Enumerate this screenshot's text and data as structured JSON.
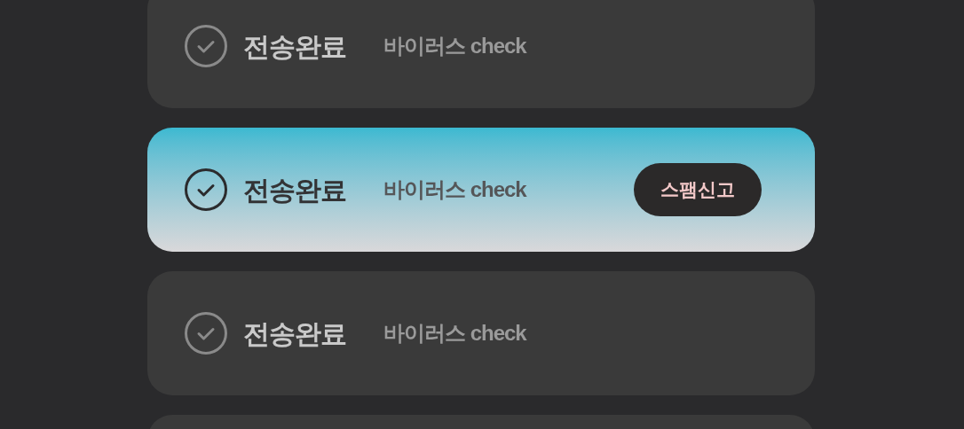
{
  "transfers": [
    {
      "status": "전송완료",
      "detail": "바이러스 check",
      "selected": false
    },
    {
      "status": "전송완료",
      "detail": "바이러스 check",
      "selected": true,
      "action": "스팸신고"
    },
    {
      "status": "전송완료",
      "detail": "바이러스 check",
      "selected": false
    },
    {
      "selected": false
    }
  ]
}
